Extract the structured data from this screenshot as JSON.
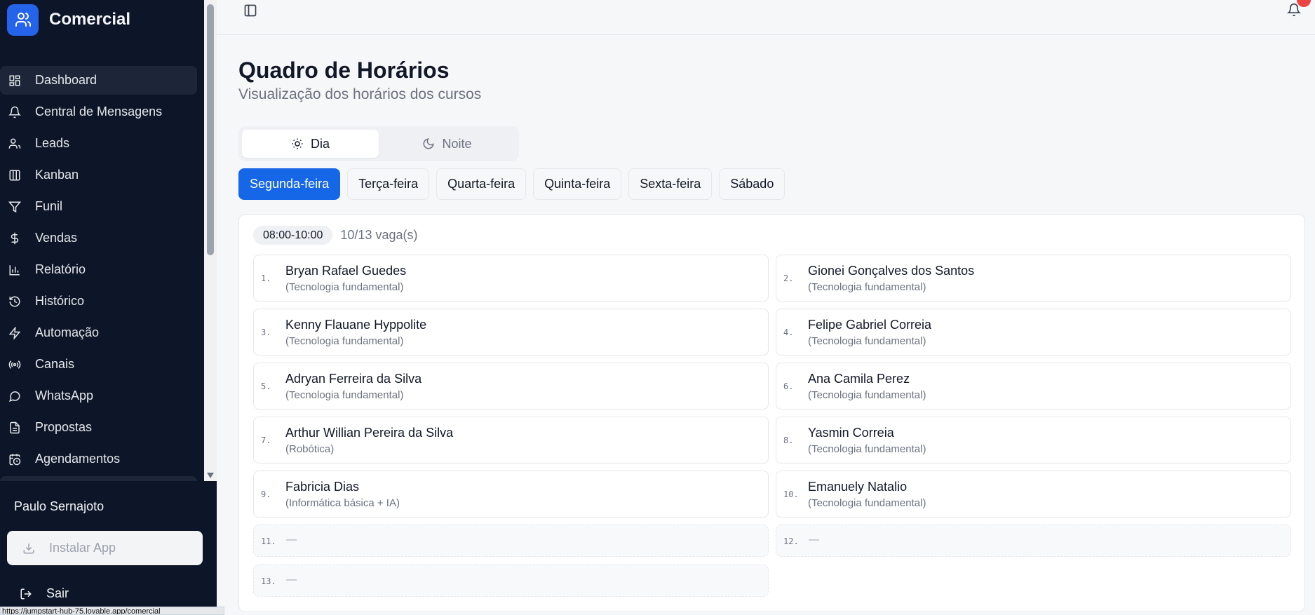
{
  "sidebar": {
    "brand": "Comercial",
    "items": [
      {
        "label": "Dashboard",
        "icon": "grid-icon"
      },
      {
        "label": "Central de Mensagens",
        "icon": "bell-icon"
      },
      {
        "label": "Leads",
        "icon": "users-icon"
      },
      {
        "label": "Kanban",
        "icon": "columns-icon"
      },
      {
        "label": "Funil",
        "icon": "filter-icon"
      },
      {
        "label": "Vendas",
        "icon": "dollar-icon"
      },
      {
        "label": "Relatório",
        "icon": "bar-chart-icon"
      },
      {
        "label": "Histórico",
        "icon": "history-icon"
      },
      {
        "label": "Automação",
        "icon": "zap-icon"
      },
      {
        "label": "Canais",
        "icon": "radio-icon"
      },
      {
        "label": "WhatsApp",
        "icon": "message-circle-icon"
      },
      {
        "label": "Propostas",
        "icon": "file-text-icon"
      },
      {
        "label": "Agendamentos",
        "icon": "calendar-clock-icon"
      }
    ],
    "user_name": "Paulo Sernajoto",
    "install_label": "Instalar App",
    "logout_label": "Sair",
    "url_tooltip": "https://jumpstart-hub-75.lovable.app/comercial"
  },
  "header": {
    "title": "Quadro de Horários",
    "subtitle": "Visualização dos horários dos cursos"
  },
  "shifts": [
    {
      "label": "Dia",
      "icon": "sun-icon",
      "active": true
    },
    {
      "label": "Noite",
      "icon": "moon-icon",
      "active": false
    }
  ],
  "days": [
    {
      "label": "Segunda-feira",
      "active": true
    },
    {
      "label": "Terça-feira",
      "active": false
    },
    {
      "label": "Quarta-feira",
      "active": false
    },
    {
      "label": "Quinta-feira",
      "active": false
    },
    {
      "label": "Sexta-feira",
      "active": false
    },
    {
      "label": "Sábado",
      "active": false
    }
  ],
  "slot": {
    "time": "08:00-10:00",
    "vacancies": "10/13 vaga(s)",
    "seats": [
      {
        "num": "1.",
        "name": "Bryan Rafael Guedes",
        "course": "(Tecnologia fundamental)"
      },
      {
        "num": "2.",
        "name": "Gionei Gonçalves dos Santos",
        "course": "(Tecnologia fundamental)"
      },
      {
        "num": "3.",
        "name": "Kenny Flauane Hyppolite",
        "course": "(Tecnologia fundamental)"
      },
      {
        "num": "4.",
        "name": "Felipe Gabriel Correia",
        "course": "(Tecnologia fundamental)"
      },
      {
        "num": "5.",
        "name": "Adryan Ferreira da Silva",
        "course": "(Tecnologia fundamental)"
      },
      {
        "num": "6.",
        "name": "Ana Camila Perez",
        "course": "(Tecnologia fundamental)"
      },
      {
        "num": "7.",
        "name": "Arthur Willian Pereira da Silva",
        "course": "(Robótica)"
      },
      {
        "num": "8.",
        "name": "Yasmin Correia",
        "course": "(Tecnologia fundamental)"
      },
      {
        "num": "9.",
        "name": "Fabricia Dias",
        "course": "(Informática básica + IA)"
      },
      {
        "num": "10.",
        "name": "Emanuely Natalio",
        "course": "(Tecnologia fundamental)"
      }
    ],
    "empty_seats": [
      {
        "num": "11.",
        "placeholder": "—"
      },
      {
        "num": "12.",
        "placeholder": "—"
      },
      {
        "num": "13.",
        "placeholder": "—"
      }
    ]
  },
  "colors": {
    "accent": "#1667e8",
    "sidebar_bg": "#0d1628",
    "notification_badge": "#ef4444"
  }
}
